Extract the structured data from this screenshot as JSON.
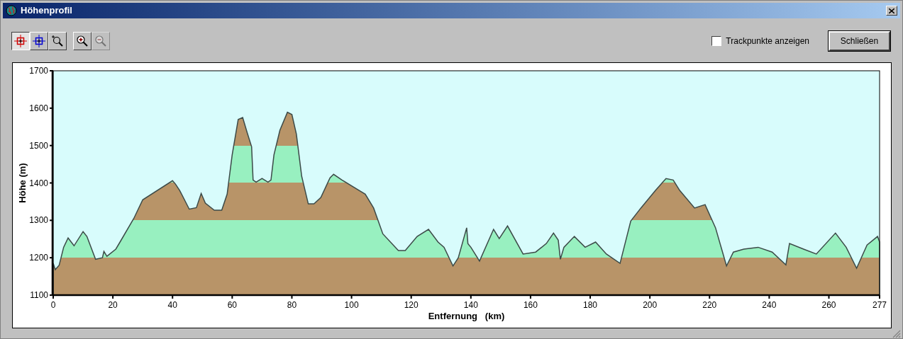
{
  "window": {
    "title": "Höhenprofil"
  },
  "tools": [
    {
      "kind": "start",
      "selected": true,
      "disabled": false
    },
    {
      "kind": "end",
      "selected": false,
      "disabled": false
    },
    {
      "kind": "zoombox",
      "selected": false,
      "disabled": false
    },
    {
      "kind": "zoomin",
      "selected": false,
      "disabled": false
    },
    {
      "kind": "zoomout",
      "selected": false,
      "disabled": true
    }
  ],
  "trackpoints": {
    "label": "Trackpunkte anzeigen",
    "checked": false
  },
  "close_button": "Schließen",
  "profile": {
    "chart_data": {
      "type": "area",
      "xlabel": "Entfernung   (km)",
      "ylabel": "Höhe (m)",
      "x": [
        0,
        0.7,
        2,
        3.5,
        5,
        7,
        10,
        11.3,
        14.2,
        16.5,
        17,
        18,
        21,
        22.4,
        27,
        30,
        40,
        41,
        42.4,
        45.6,
        48,
        49.6,
        51,
        54,
        56.5,
        58.3,
        60,
        62,
        63.5,
        65,
        66.5,
        67,
        68,
        70,
        72,
        73,
        74,
        76,
        78.5,
        80,
        81.5,
        83.3,
        85.5,
        87.4,
        89.7,
        92.8,
        94,
        96.8,
        104.6,
        107.4,
        110.5,
        115.7,
        118,
        122,
        125.8,
        129,
        131,
        134,
        135.8,
        138.6,
        139,
        140,
        142.9,
        147.6,
        149.5,
        152.3,
        157.5,
        161.7,
        165.3,
        167.7,
        169.3,
        170,
        171.2,
        174.7,
        178.3,
        181.8,
        185.4,
        190,
        193.6,
        197,
        201.9,
        205.4,
        207.8,
        210,
        215,
        218.5,
        222,
        225.7,
        228,
        231.5,
        236.3,
        241,
        245.6,
        246.8,
        251.5,
        255.8,
        262.2,
        265.8,
        269.3,
        272.8,
        276.3,
        277
      ],
      "series": [
        {
          "color": "#3c4a48",
          "values": [
            1185,
            1168,
            1180,
            1228,
            1253,
            1232,
            1270,
            1257,
            1196,
            1200,
            1217,
            1204,
            1223,
            1242,
            1305,
            1355,
            1406,
            1397,
            1380,
            1330,
            1334,
            1372,
            1346,
            1327,
            1327,
            1370,
            1475,
            1570,
            1575,
            1535,
            1497,
            1408,
            1402,
            1412,
            1402,
            1408,
            1475,
            1541,
            1589,
            1583,
            1531,
            1418,
            1344,
            1344,
            1361,
            1414,
            1423,
            1408,
            1370,
            1333,
            1264,
            1219,
            1219,
            1257,
            1276,
            1242,
            1228,
            1178,
            1200,
            1280,
            1238,
            1228,
            1191,
            1276,
            1251,
            1285,
            1210,
            1215,
            1238,
            1266,
            1247,
            1196,
            1228,
            1257,
            1228,
            1242,
            1210,
            1185,
            1298,
            1333,
            1380,
            1412,
            1408,
            1380,
            1333,
            1342,
            1280,
            1178,
            1215,
            1223,
            1228,
            1215,
            1181,
            1238,
            1223,
            1210,
            1266,
            1228,
            1172,
            1234,
            1257,
            1242
          ]
        }
      ],
      "xlim": [
        0,
        277
      ],
      "ylim": [
        1100,
        1700
      ],
      "xticks": [
        0,
        20,
        40,
        60,
        80,
        100,
        120,
        140,
        160,
        180,
        200,
        220,
        240,
        260,
        277
      ],
      "yticks": [
        1100,
        1200,
        1300,
        1400,
        1500,
        1600,
        1700
      ]
    }
  }
}
